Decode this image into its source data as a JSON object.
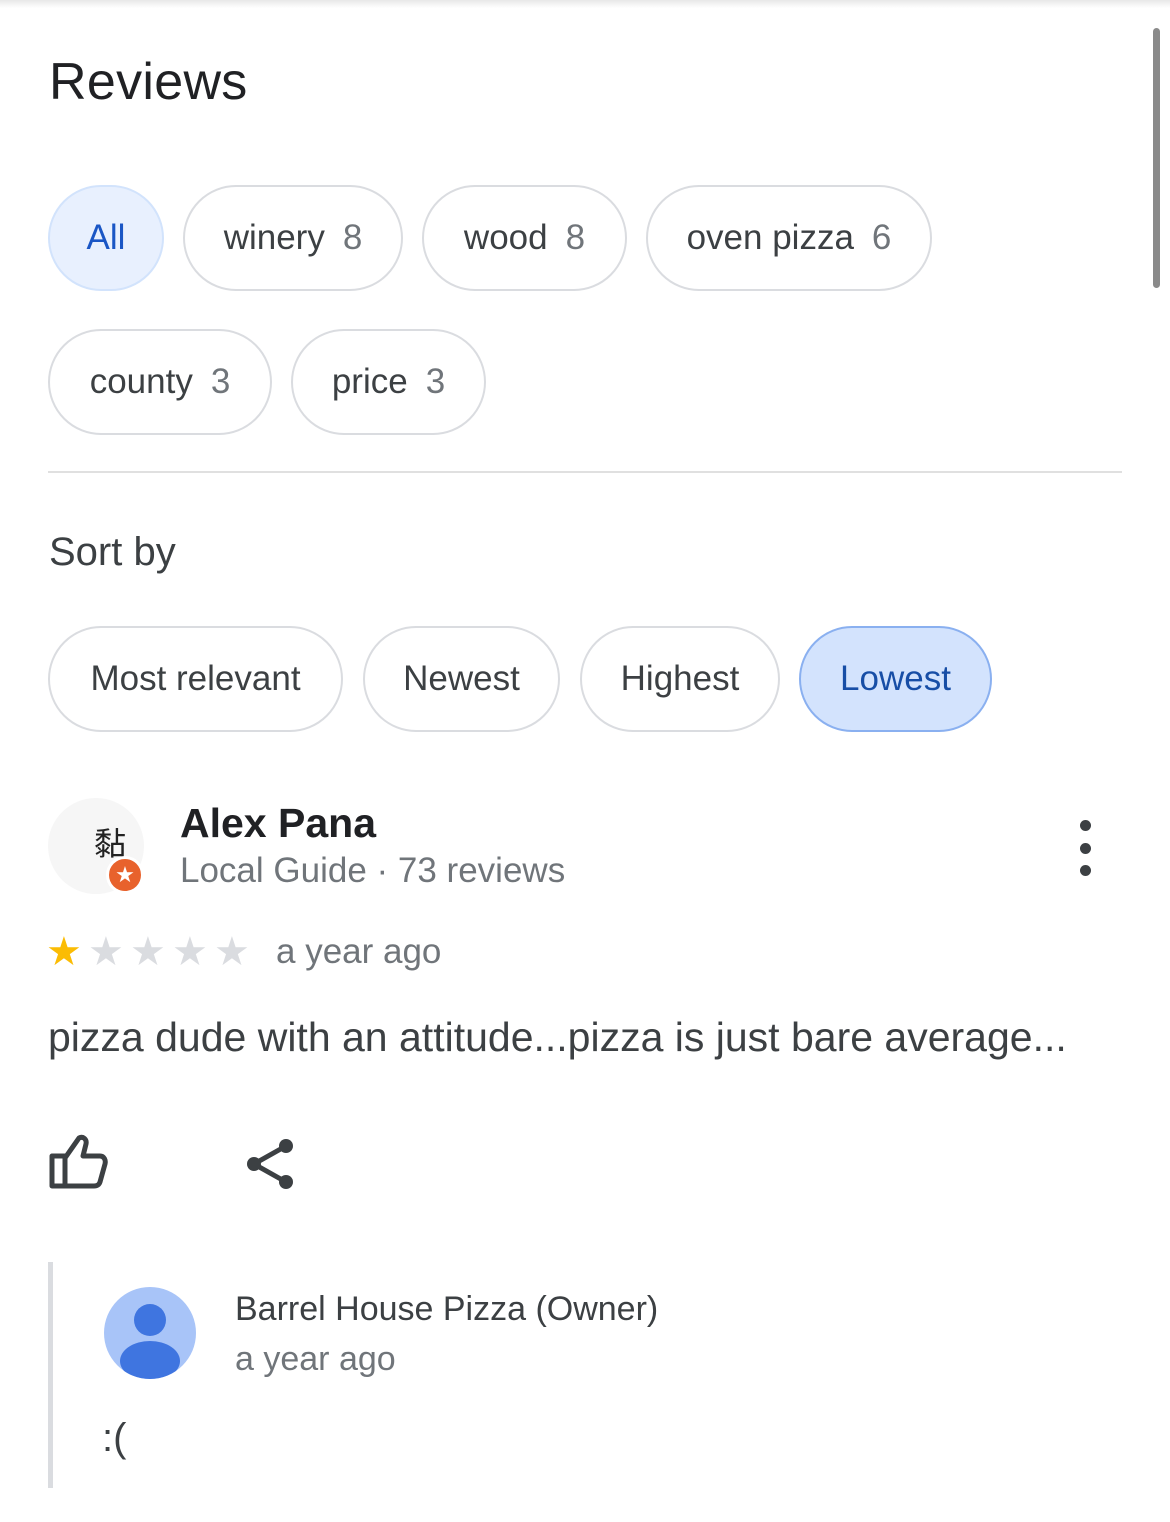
{
  "reviews_title": "Reviews",
  "topic_chips": [
    {
      "label": "All",
      "count": "",
      "selected": true
    },
    {
      "label": "winery",
      "count": "8",
      "selected": false
    },
    {
      "label": "wood",
      "count": "8",
      "selected": false
    },
    {
      "label": "oven pizza",
      "count": "6",
      "selected": false
    },
    {
      "label": "county",
      "count": "3",
      "selected": false
    },
    {
      "label": "price",
      "count": "3",
      "selected": false
    }
  ],
  "sort": {
    "label": "Sort by",
    "options": [
      {
        "label": "Most relevant",
        "selected": false
      },
      {
        "label": "Newest",
        "selected": false
      },
      {
        "label": "Highest",
        "selected": false
      },
      {
        "label": "Lowest",
        "selected": true
      }
    ]
  },
  "review": {
    "author": "Alex Pana",
    "author_meta": "Local Guide · 73 reviews",
    "avatar_glyph": "黏",
    "rating": 1,
    "rating_max": 5,
    "date": "a year ago",
    "text": "pizza dude with an attitude...pizza is just bare average..."
  },
  "owner_reply": {
    "name": "Barrel House Pizza (Owner)",
    "date": "a year ago",
    "text": ":("
  },
  "colors": {
    "selected_chip_bg": "#e8f0fe",
    "selected_sort_bg": "#d3e3fd",
    "accent_text": "#1a56c5",
    "star_on": "#fbbc04",
    "star_off": "#dadce0",
    "guide_badge": "#e8622c",
    "owner_avatar": "#a8c4f8"
  },
  "icons": {
    "more": "more-vert-icon",
    "like": "thumb-up-icon",
    "share": "share-icon",
    "badge": "local-guide-badge-icon",
    "owner_avatar": "person-icon"
  }
}
